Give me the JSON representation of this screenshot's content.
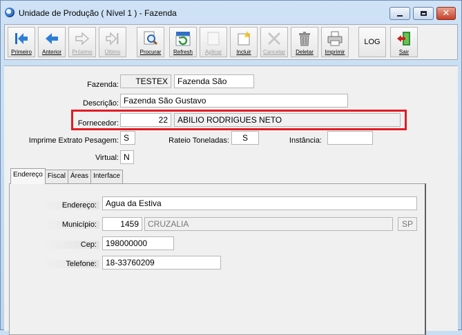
{
  "window": {
    "title": "Unidade de Produção ( Nível 1 ) - Fazenda"
  },
  "toolbar": {
    "primeiro": "Primeiro",
    "anterior": "Anterior",
    "proximo": "Próximo",
    "ultimo": "Último",
    "procurar": "Procurar",
    "refresh": "Refresh",
    "aplicar": "Aplicar",
    "incluir": "Incluir",
    "cancelar": "Cancelar",
    "deletar": "Deletar",
    "imprimir": "Imprimir",
    "log": "LOG",
    "sair": "Sair"
  },
  "form": {
    "fazenda_label": "Fazenda:",
    "fazenda_code": "TESTEX",
    "fazenda_name": "Fazenda São",
    "descricao_label": "Descrição:",
    "descricao_value": "Fazenda São Gustavo",
    "fornecedor_label": "Fornecedor:",
    "fornecedor_code": "22",
    "fornecedor_name": "ABILIO RODRIGUES NETO",
    "imprime_label": "Imprime Extrato Pesagem:",
    "imprime_value": "S",
    "rateio_label": "Rateio Toneladas:",
    "rateio_value": "S",
    "instancia_label": "Instância:",
    "instancia_value": "",
    "virtual_label": "Virtual:",
    "virtual_value": "N"
  },
  "tabs": [
    "Endereço",
    "Fiscal",
    "Áreas",
    "Interface"
  ],
  "address": {
    "endereco_label": "Endereço:",
    "endereco_value": "Agua da Estiva",
    "municipio_label": "Município:",
    "municipio_code": "1459",
    "municipio_name": "CRUZALIA",
    "uf": "SP",
    "cep_label": "Cep:",
    "cep_value": "198000000",
    "telefone_label": "Telefone:",
    "telefone_value": "18-33760209"
  },
  "colors": {
    "highlight": "#e21b23",
    "titlebar": "#c9def3"
  }
}
